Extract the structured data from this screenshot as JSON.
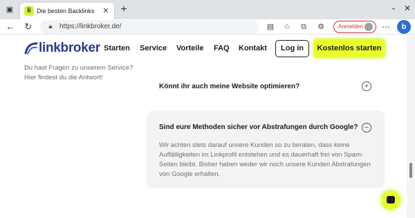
{
  "browser": {
    "tab_title": "Die besten Backlinks kaufen zu Top",
    "tab_favicon_text": "li",
    "address": "https://linkbroker.de/",
    "signin_label": "Anmelden"
  },
  "site": {
    "logo_text": "linkbroker",
    "nav": [
      "Starten",
      "Service",
      "Vorteile",
      "FAQ",
      "Kontakt"
    ],
    "login_label": "Log in",
    "cta_label": "Kostenlos starten",
    "accent_color": "#e8ff2a",
    "brand_color": "#2b3a8c"
  },
  "faq": {
    "intro": "Du hast Fragen zu unserem Service? Hier findest du die Antwort!",
    "items": [
      {
        "question": "Könnt ihr auch meine Website optimieren?",
        "expanded": false,
        "answer": ""
      },
      {
        "question": "Sind eure Methoden sicher vor Abstrafungen durch Google?",
        "expanded": true,
        "answer": "Wir achten stets darauf unsere Kunden so zu beraten, dass keine Auffälligkeiten im Linkprofil entstehen und es dauerhaft frei von Spam-Seiten bleibt. Bisher haben weder wir noch unsere Kunden Abstrafungen von Google erhalten."
      }
    ]
  },
  "icons": {
    "expand": "+",
    "collapse": "−"
  }
}
